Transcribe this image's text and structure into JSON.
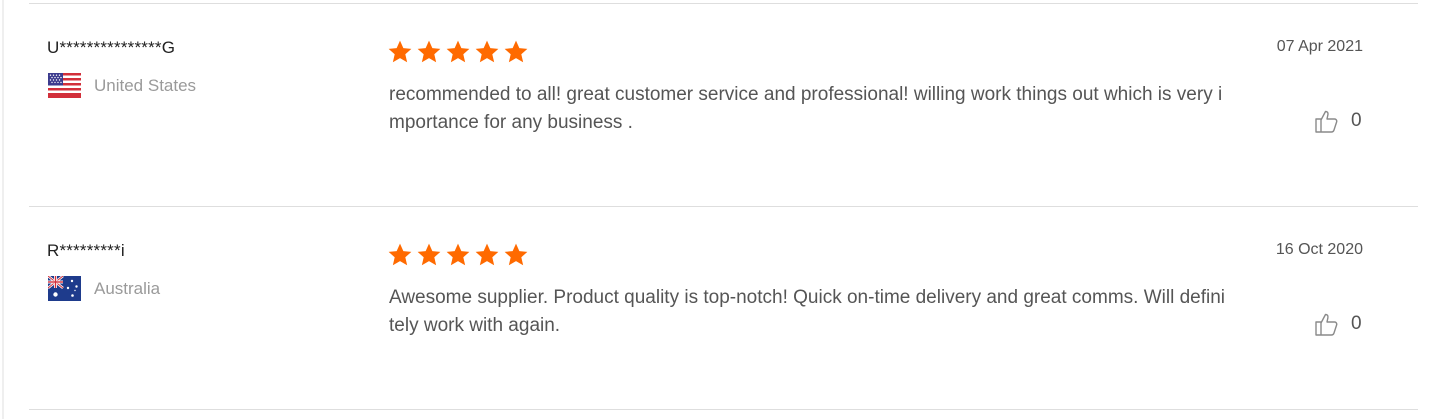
{
  "colors": {
    "star": "#ff6a00",
    "text_primary": "#222222",
    "text_secondary": "#555555",
    "text_muted": "#9a9a9a",
    "divider": "#dedede"
  },
  "reviews": [
    {
      "buyer": "U***************G",
      "country": "United States",
      "flag_icon": "us-flag-icon",
      "rating": 5,
      "comment": "recommended to all!  great customer service and professional! willing work things out which is very importance for any business .",
      "date": "07 Apr 2021",
      "likes": "0"
    },
    {
      "buyer": "R*********i",
      "country": "Australia",
      "flag_icon": "australia-flag-icon",
      "rating": 5,
      "comment": "Awesome supplier. Product quality is top-notch! Quick on-time delivery and great comms. Will definitely work with again.",
      "date": "16 Oct 2020",
      "likes": "0"
    }
  ]
}
